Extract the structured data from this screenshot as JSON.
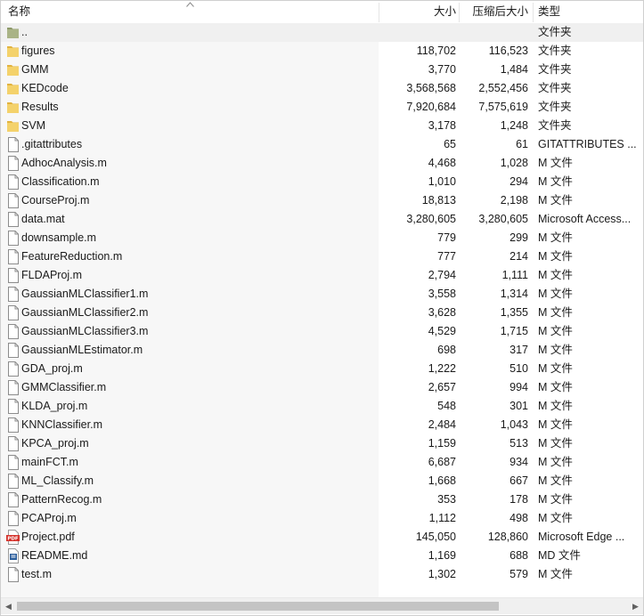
{
  "columns": {
    "name": "名称",
    "size": "大小",
    "compressed": "压缩后大小",
    "type": "类型"
  },
  "files": [
    {
      "name": "..",
      "size": "",
      "compressed": "",
      "type": "文件夹",
      "icon": "parent-folder-icon"
    },
    {
      "name": "figures",
      "size": "118,702",
      "compressed": "116,523",
      "type": "文件夹",
      "icon": "folder-icon"
    },
    {
      "name": "GMM",
      "size": "3,770",
      "compressed": "1,484",
      "type": "文件夹",
      "icon": "folder-icon"
    },
    {
      "name": "KEDcode",
      "size": "3,568,568",
      "compressed": "2,552,456",
      "type": "文件夹",
      "icon": "folder-icon"
    },
    {
      "name": "Results",
      "size": "7,920,684",
      "compressed": "7,575,619",
      "type": "文件夹",
      "icon": "folder-icon"
    },
    {
      "name": "SVM",
      "size": "3,178",
      "compressed": "1,248",
      "type": "文件夹",
      "icon": "folder-icon"
    },
    {
      "name": ".gitattributes",
      "size": "65",
      "compressed": "61",
      "type": "GITATTRIBUTES ...",
      "icon": "file-icon"
    },
    {
      "name": "AdhocAnalysis.m",
      "size": "4,468",
      "compressed": "1,028",
      "type": "M 文件",
      "icon": "file-icon"
    },
    {
      "name": "Classification.m",
      "size": "1,010",
      "compressed": "294",
      "type": "M 文件",
      "icon": "file-icon"
    },
    {
      "name": "CourseProj.m",
      "size": "18,813",
      "compressed": "2,198",
      "type": "M 文件",
      "icon": "file-icon"
    },
    {
      "name": "data.mat",
      "size": "3,280,605",
      "compressed": "3,280,605",
      "type": "Microsoft Access...",
      "icon": "file-icon"
    },
    {
      "name": "downsample.m",
      "size": "779",
      "compressed": "299",
      "type": "M 文件",
      "icon": "file-icon"
    },
    {
      "name": "FeatureReduction.m",
      "size": "777",
      "compressed": "214",
      "type": "M 文件",
      "icon": "file-icon"
    },
    {
      "name": "FLDAProj.m",
      "size": "2,794",
      "compressed": "1,111",
      "type": "M 文件",
      "icon": "file-icon"
    },
    {
      "name": "GaussianMLClassifier1.m",
      "size": "3,558",
      "compressed": "1,314",
      "type": "M 文件",
      "icon": "file-icon"
    },
    {
      "name": "GaussianMLClassifier2.m",
      "size": "3,628",
      "compressed": "1,355",
      "type": "M 文件",
      "icon": "file-icon"
    },
    {
      "name": "GaussianMLClassifier3.m",
      "size": "4,529",
      "compressed": "1,715",
      "type": "M 文件",
      "icon": "file-icon"
    },
    {
      "name": "GaussianMLEstimator.m",
      "size": "698",
      "compressed": "317",
      "type": "M 文件",
      "icon": "file-icon"
    },
    {
      "name": "GDA_proj.m",
      "size": "1,222",
      "compressed": "510",
      "type": "M 文件",
      "icon": "file-icon"
    },
    {
      "name": "GMMClassifier.m",
      "size": "2,657",
      "compressed": "994",
      "type": "M 文件",
      "icon": "file-icon"
    },
    {
      "name": "KLDA_proj.m",
      "size": "548",
      "compressed": "301",
      "type": "M 文件",
      "icon": "file-icon"
    },
    {
      "name": "KNNClassifier.m",
      "size": "2,484",
      "compressed": "1,043",
      "type": "M 文件",
      "icon": "file-icon"
    },
    {
      "name": "KPCA_proj.m",
      "size": "1,159",
      "compressed": "513",
      "type": "M 文件",
      "icon": "file-icon"
    },
    {
      "name": "mainFCT.m",
      "size": "6,687",
      "compressed": "934",
      "type": "M 文件",
      "icon": "file-icon"
    },
    {
      "name": "ML_Classify.m",
      "size": "1,668",
      "compressed": "667",
      "type": "M 文件",
      "icon": "file-icon"
    },
    {
      "name": "PatternRecog.m",
      "size": "353",
      "compressed": "178",
      "type": "M 文件",
      "icon": "file-icon"
    },
    {
      "name": "PCAProj.m",
      "size": "1,112",
      "compressed": "498",
      "type": "M 文件",
      "icon": "file-icon"
    },
    {
      "name": "Project.pdf",
      "size": "145,050",
      "compressed": "128,860",
      "type": "Microsoft Edge ...",
      "icon": "pdf-icon"
    },
    {
      "name": "README.md",
      "size": "1,169",
      "compressed": "688",
      "type": "MD 文件",
      "icon": "markdown-file-icon"
    },
    {
      "name": "test.m",
      "size": "1,302",
      "compressed": "579",
      "type": "M 文件",
      "icon": "file-icon"
    }
  ],
  "scrollbar": {
    "visible_fraction": 0.79
  },
  "colors": {
    "folder": "#f4d26b",
    "folder_dark": "#e2b33f",
    "pdf": "#d4312a",
    "md": "#2b5d9b"
  }
}
